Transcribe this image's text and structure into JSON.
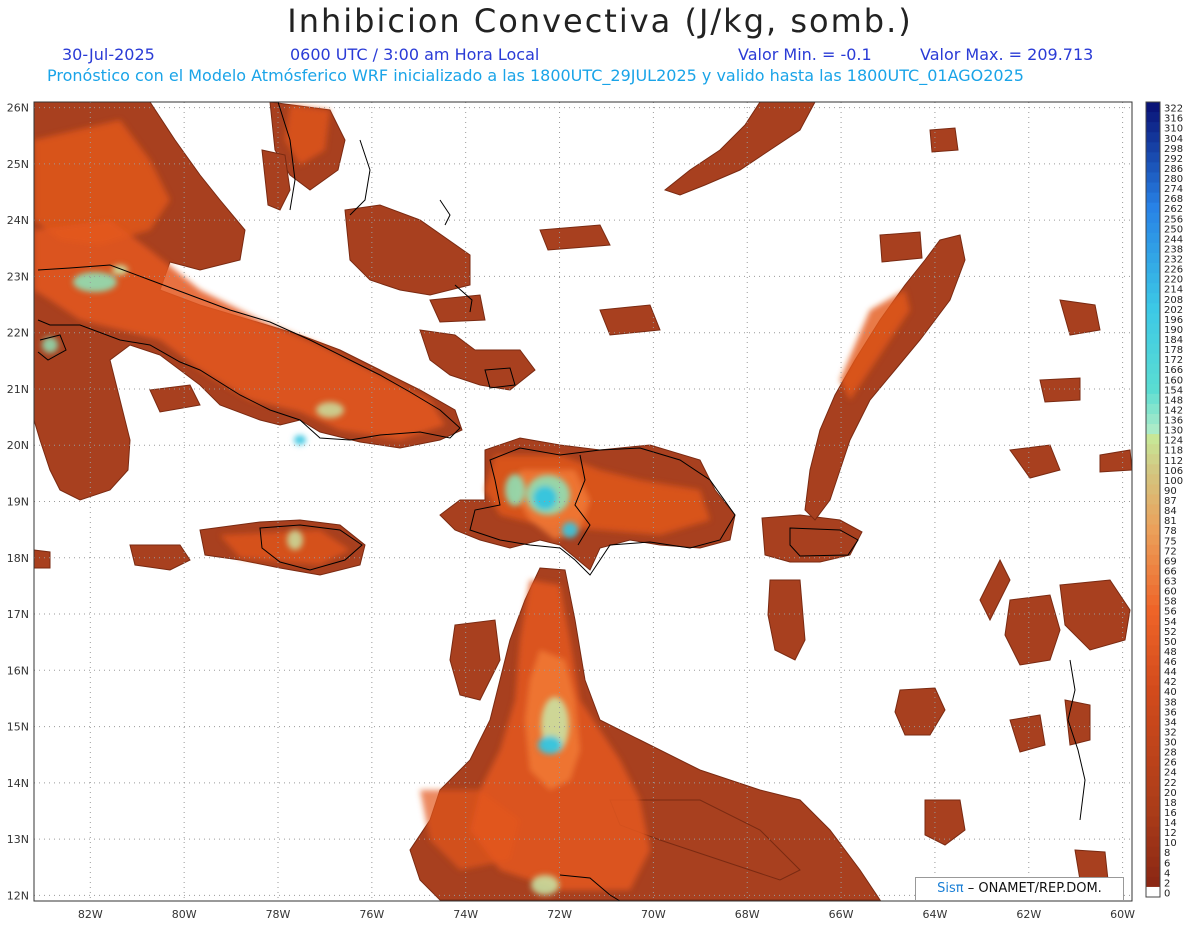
{
  "header": {
    "title": "Inhibicion Convectiva (J/kg, somb.)",
    "date": "30-Jul-2025",
    "time": "0600 UTC / 3:00 am Hora Local",
    "value_min": "Valor Min. = -0.1",
    "value_max": "Valor Max. = 209.713",
    "forecast_line": "Pronóstico con el Modelo Atmósferico WRF inicializado a las 1800UTC_29JUL2025 y valido hasta las  1800UTC_01AGO2025"
  },
  "map": {
    "lon_range": [
      -83.2,
      -59.8
    ],
    "lat_range": [
      11.9,
      26.1
    ],
    "lon_ticks": [
      "82W",
      "80W",
      "78W",
      "76W",
      "74W",
      "72W",
      "70W",
      "68W",
      "66W",
      "64W",
      "62W",
      "60W"
    ],
    "lon_tick_values": [
      -82,
      -80,
      -78,
      -76,
      -74,
      -72,
      -70,
      -68,
      -66,
      -64,
      -62,
      -60
    ],
    "lat_ticks": [
      "12N",
      "13N",
      "14N",
      "15N",
      "16N",
      "17N",
      "18N",
      "19N",
      "20N",
      "21N",
      "22N",
      "23N",
      "24N",
      "25N",
      "26N"
    ],
    "lat_tick_values": [
      12,
      13,
      14,
      15,
      16,
      17,
      18,
      19,
      20,
      21,
      22,
      23,
      24,
      25,
      26
    ],
    "grid": true,
    "colors": {
      "field_base": "#a8401f",
      "field_mid": "#e4571c",
      "field_high": "#f27a35",
      "moist": "#8fe0b5",
      "peak": "#34c4e0",
      "coast": "#000000"
    }
  },
  "colorbar": {
    "labels": [
      "322",
      "316",
      "310",
      "304",
      "298",
      "292",
      "286",
      "280",
      "274",
      "268",
      "262",
      "256",
      "250",
      "244",
      "238",
      "232",
      "226",
      "220",
      "214",
      "208",
      "202",
      "196",
      "190",
      "184",
      "178",
      "172",
      "166",
      "160",
      "154",
      "148",
      "142",
      "136",
      "130",
      "124",
      "118",
      "112",
      "106",
      "100",
      "90",
      "87",
      "84",
      "81",
      "78",
      "75",
      "72",
      "69",
      "66",
      "63",
      "60",
      "58",
      "56",
      "54",
      "52",
      "50",
      "48",
      "46",
      "44",
      "42",
      "40",
      "38",
      "36",
      "34",
      "32",
      "30",
      "28",
      "26",
      "24",
      "22",
      "20",
      "18",
      "16",
      "14",
      "12",
      "10",
      "8",
      "6",
      "4",
      "2",
      "0"
    ]
  },
  "credit": {
    "sis": "Sisπ",
    "org": "– ONAMET/REP.DOM."
  }
}
